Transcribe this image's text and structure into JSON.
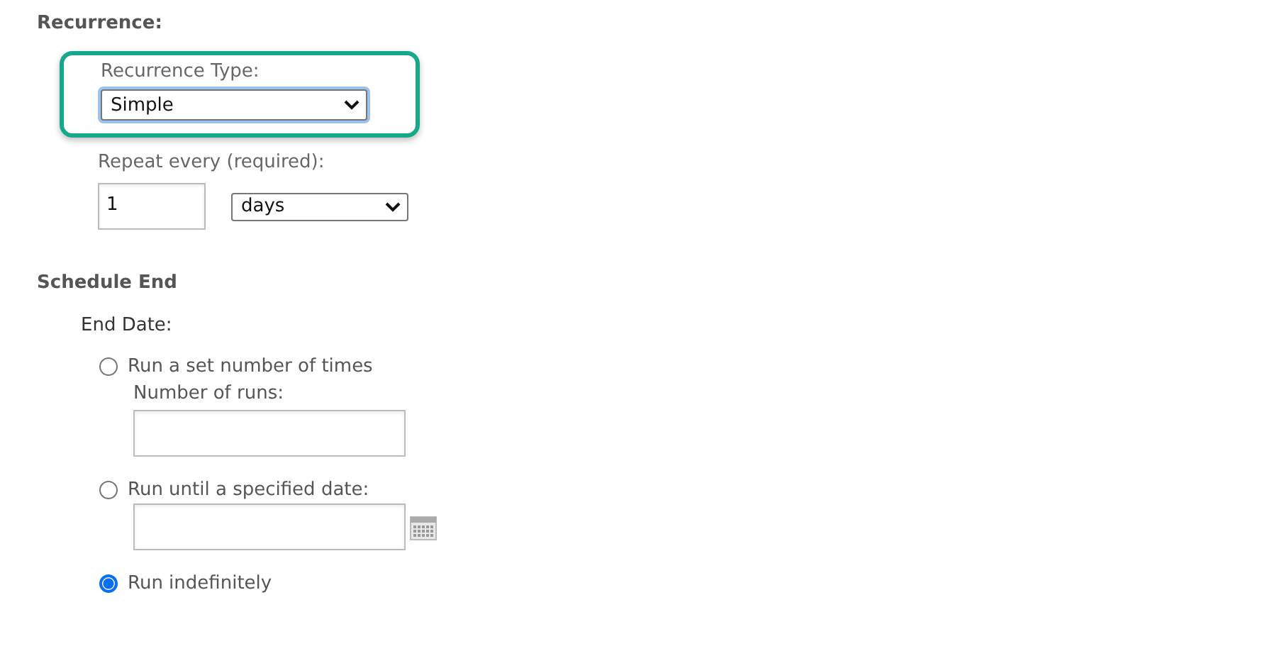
{
  "recurrence": {
    "heading": "Recurrence:",
    "recurrence_type": {
      "label": "Recurrence Type:",
      "value": "Simple",
      "highlighted": true
    },
    "repeat_every": {
      "label": "Repeat every (required):",
      "value": "1",
      "unit": "days"
    }
  },
  "schedule_end": {
    "heading": "Schedule End",
    "end_date_label": "End Date:",
    "options": [
      {
        "kind": "number",
        "label": "Run a set number of times",
        "selected": false,
        "field_label": "Number of runs:"
      },
      {
        "kind": "date",
        "label": "Run until a specified date:",
        "selected": false
      },
      {
        "kind": "plain",
        "label": "Run indefinitely",
        "selected": true
      }
    ]
  }
}
